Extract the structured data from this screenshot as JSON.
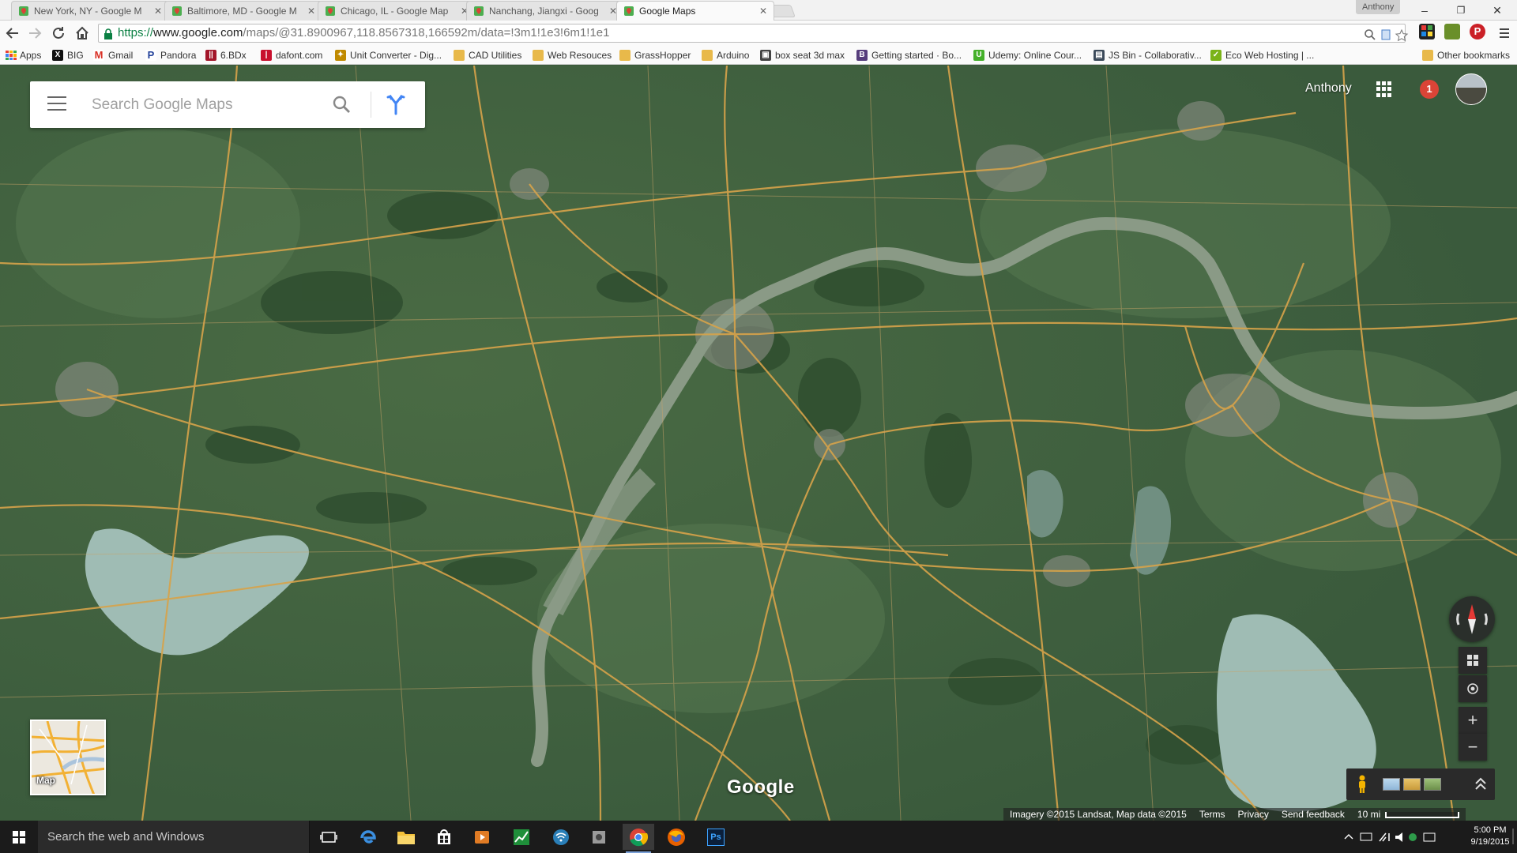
{
  "window": {
    "profile_name": "Anthony",
    "minimize_glyph": "–",
    "restore_glyph": "❐",
    "close_glyph": "✕"
  },
  "tabs": [
    {
      "title": "New York, NY - Google M",
      "active": false
    },
    {
      "title": "Baltimore, MD - Google M",
      "active": false
    },
    {
      "title": "Chicago, IL - Google Map",
      "active": false
    },
    {
      "title": "Nanchang, Jiangxi - Goog",
      "active": false
    },
    {
      "title": "Google Maps",
      "active": true
    }
  ],
  "tab_close_glyph": "✕",
  "address_bar": {
    "url_scheme": "https://",
    "url_host": "www.google.com",
    "url_path": "/maps/@31.8900967,118.8567318,166592m/data=!3m1!1e3!6m1!1e1"
  },
  "bookmarks": [
    {
      "label": "Apps",
      "icon": "apps-grid-icon",
      "color": "#4285f4"
    },
    {
      "label": "BIG",
      "icon": "big-icon",
      "color": "#111111"
    },
    {
      "label": "Gmail",
      "icon": "gmail-icon",
      "color": "#d93025"
    },
    {
      "label": "Pandora",
      "icon": "pandora-icon",
      "color": "#224099"
    },
    {
      "label": "6.BDx",
      "icon": "6bdx-icon",
      "color": "#a3162a"
    },
    {
      "label": "dafont.com",
      "icon": "dafont-icon",
      "color": "#c8102e"
    },
    {
      "label": "Unit Converter - Dig...",
      "icon": "unit-converter-icon",
      "color": "#c08a00"
    },
    {
      "label": "CAD Utilities",
      "icon": "folder-icon",
      "color": "#e8b94a"
    },
    {
      "label": "Web Resouces",
      "icon": "folder-icon",
      "color": "#e8b94a"
    },
    {
      "label": "GrassHopper",
      "icon": "folder-icon",
      "color": "#e8b94a"
    },
    {
      "label": "Arduino",
      "icon": "folder-icon",
      "color": "#e8b94a"
    },
    {
      "label": "box seat 3d max",
      "icon": "box-seat-icon",
      "color": "#444444"
    },
    {
      "label": "Getting started · Bo...",
      "icon": "bootstrap-icon",
      "color": "#563d7c"
    },
    {
      "label": "Udemy: Online Cour...",
      "icon": "udemy-icon",
      "color": "#44b02a"
    },
    {
      "label": "JS Bin - Collaborativ...",
      "icon": "jsbin-icon",
      "color": "#3b4a5a"
    },
    {
      "label": "Eco Web Hosting | ...",
      "icon": "eco-hosting-icon",
      "color": "#7ab317"
    }
  ],
  "other_bookmarks": "Other bookmarks",
  "maps": {
    "search_placeholder": "Search Google Maps",
    "account_name": "Anthony",
    "notification_count": "1",
    "minimap_label": "Map",
    "logo_text": "Google",
    "attribution": "Imagery ©2015 Landsat, Map data ©2015",
    "terms": "Terms",
    "privacy": "Privacy",
    "send_feedback": "Send feedback",
    "scale_label": "10 mi",
    "zoom_in": "+",
    "zoom_out": "−",
    "expand_glyph": "ˆ"
  },
  "taskbar": {
    "search_placeholder": "Search the web and Windows",
    "time": "5:00 PM",
    "date": "9/19/2015",
    "apps": [
      {
        "name": "task-view-icon",
        "active": false
      },
      {
        "name": "edge-icon",
        "active": false
      },
      {
        "name": "file-explorer-icon",
        "active": false
      },
      {
        "name": "store-icon",
        "active": false
      },
      {
        "name": "media-player-icon",
        "active": false
      },
      {
        "name": "chart-app-icon",
        "active": false
      },
      {
        "name": "network-app-icon",
        "active": false
      },
      {
        "name": "settings-app-icon",
        "active": false
      },
      {
        "name": "chrome-icon",
        "active": true
      },
      {
        "name": "firefox-icon",
        "active": false
      },
      {
        "name": "photoshop-icon",
        "active": false
      }
    ],
    "photoshop_label": "Ps"
  },
  "colors": {
    "terrain_base": "#3f6240",
    "river": "#8a9a86",
    "lake": "#9fbcb4",
    "road": "#d7a34a",
    "urban": "#8a8d86"
  }
}
